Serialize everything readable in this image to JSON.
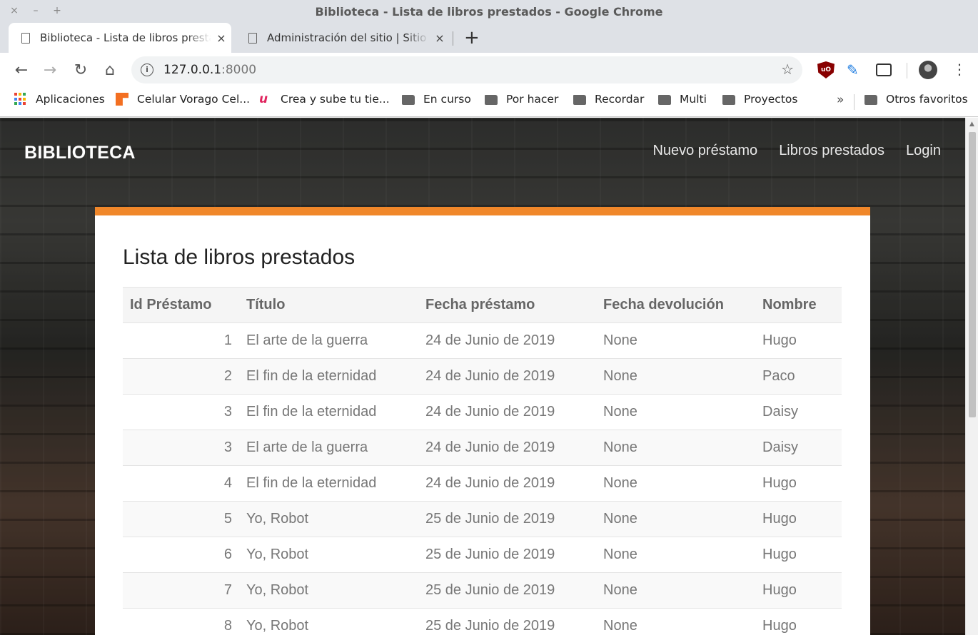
{
  "window": {
    "title": "Biblioteca - Lista de libros prestados - Google Chrome",
    "controls": [
      "×",
      "–",
      "+"
    ]
  },
  "tabs": [
    {
      "label": "Biblioteca - Lista de libros prestados",
      "close": "×"
    },
    {
      "label": "Administración del sitio | Sitio de administración de Django",
      "close": "×"
    }
  ],
  "new_tab": "+",
  "toolbar": {
    "back": "←",
    "forward": "→",
    "reload": "↻",
    "home": "⌂",
    "url_host": "127.0.0.1",
    "url_port": ":8000",
    "info": "i",
    "star": "☆",
    "ublock": "uO",
    "feather": "✎",
    "menu": "⋮"
  },
  "bookmarks": {
    "items": [
      {
        "label": "Aplicaciones",
        "icon": "apps-grid-icon"
      },
      {
        "label": "Celular Vorago Cel...",
        "icon": "vorago-icon"
      },
      {
        "label": "Crea y sube tu tie...",
        "icon": "u-logo-icon"
      },
      {
        "label": "En curso",
        "icon": "folder-icon"
      },
      {
        "label": "Por hacer",
        "icon": "folder-icon"
      },
      {
        "label": "Recordar",
        "icon": "folder-icon"
      },
      {
        "label": "Multi",
        "icon": "folder-icon"
      },
      {
        "label": "Proyectos",
        "icon": "folder-icon"
      }
    ],
    "more": "»",
    "other": "Otros favoritos"
  },
  "site": {
    "brand": "BIBLIOTECA",
    "nav": [
      "Nuevo préstamo",
      "Libros prestados",
      "Login"
    ],
    "accent": "#f0872a"
  },
  "page": {
    "heading": "Lista de libros prestados",
    "columns": [
      "Id Préstamo",
      "Título",
      "Fecha préstamo",
      "Fecha devolución",
      "Nombre"
    ],
    "rows": [
      [
        "1",
        "El arte de la guerra",
        "24 de Junio de 2019",
        "None",
        "Hugo"
      ],
      [
        "2",
        "El fin de la eternidad",
        "24 de Junio de 2019",
        "None",
        "Paco"
      ],
      [
        "3",
        "El fin de la eternidad",
        "24 de Junio de 2019",
        "None",
        "Daisy"
      ],
      [
        "3",
        "El arte de la guerra",
        "24 de Junio de 2019",
        "None",
        "Daisy"
      ],
      [
        "4",
        "El fin de la eternidad",
        "24 de Junio de 2019",
        "None",
        "Hugo"
      ],
      [
        "5",
        "Yo, Robot",
        "25 de Junio de 2019",
        "None",
        "Hugo"
      ],
      [
        "6",
        "Yo, Robot",
        "25 de Junio de 2019",
        "None",
        "Hugo"
      ],
      [
        "7",
        "Yo, Robot",
        "25 de Junio de 2019",
        "None",
        "Hugo"
      ],
      [
        "8",
        "Yo, Robot",
        "25 de Junio de 2019",
        "None",
        "Hugo"
      ]
    ]
  }
}
